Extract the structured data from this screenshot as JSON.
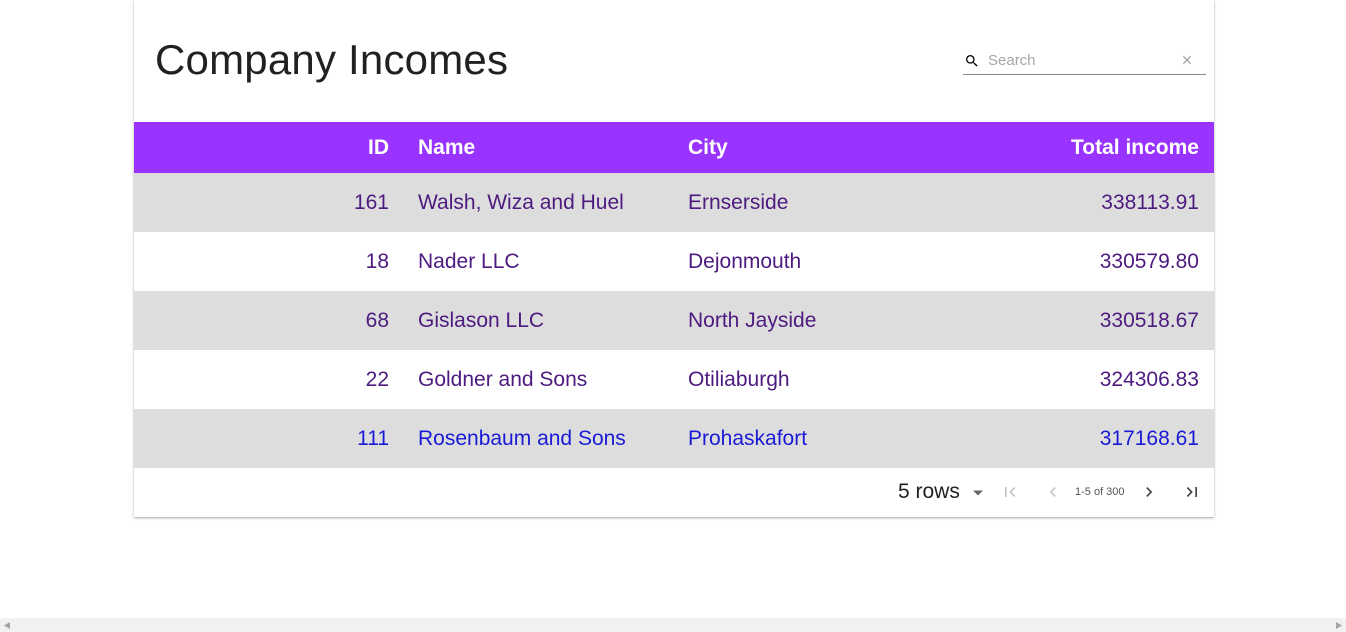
{
  "page": {
    "title": "Company Incomes",
    "search_placeholder": "Search",
    "search_value": ""
  },
  "table": {
    "columns": [
      "ID",
      "Name",
      "City",
      "Total income"
    ],
    "rows": [
      [
        "161",
        "Walsh, Wiza and Huel",
        "Ernserside",
        "338113.91"
      ],
      [
        "18",
        "Nader LLC",
        "Dejonmouth",
        "330579.80"
      ],
      [
        "68",
        "Gislason LLC",
        "North Jayside",
        "330518.67"
      ],
      [
        "22",
        "Goldner and Sons",
        "Otiliaburgh",
        "324306.83"
      ],
      [
        "111",
        "Rosenbaum and Sons",
        "Prohaskafort",
        "317168.61"
      ]
    ]
  },
  "pagination": {
    "rows_per_page": "5 rows",
    "range": "1-5 of 300"
  },
  "colors": {
    "header": "#9933ff",
    "row_stripe": "#dddddd",
    "cell_text": "#4d1a80",
    "hover_text": "#1a1ad6"
  },
  "icons": {
    "search": "search-icon",
    "clear": "close-icon",
    "dropdown": "caret-down-icon",
    "first": "first-page-icon",
    "prev": "chevron-left-icon",
    "next": "chevron-right-icon",
    "last": "last-page-icon"
  }
}
